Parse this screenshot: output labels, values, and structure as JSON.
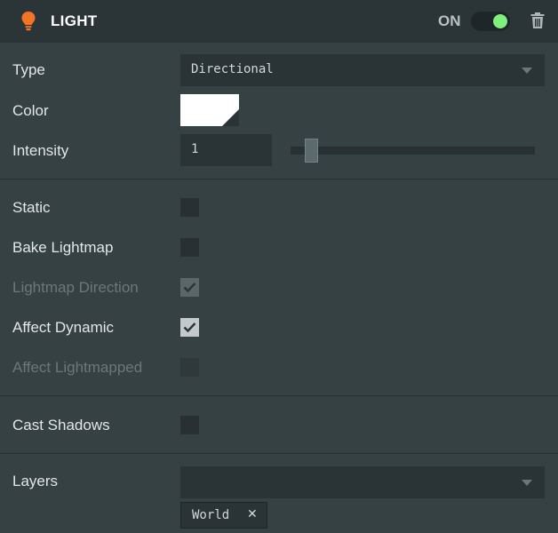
{
  "header": {
    "title": "LIGHT",
    "toggle_label": "ON",
    "enabled": true,
    "icons": {
      "bulb": "lightbulb-icon",
      "delete": "trash-icon"
    },
    "colors": {
      "bulb": "#f27424",
      "toggle_on": "#7ef07b"
    }
  },
  "type": {
    "label": "Type",
    "value": "Directional"
  },
  "color": {
    "label": "Color",
    "value": "#ffffff"
  },
  "intensity": {
    "label": "Intensity",
    "value": "1",
    "slider_fraction": 0.06
  },
  "static": {
    "label": "Static",
    "checked": false
  },
  "bake_lightmap": {
    "label": "Bake Lightmap",
    "checked": false
  },
  "lightmap_direction": {
    "label": "Lightmap Direction",
    "checked": true,
    "disabled": true
  },
  "affect_dynamic": {
    "label": "Affect Dynamic",
    "checked": true
  },
  "affect_lightmapped": {
    "label": "Affect Lightmapped",
    "checked": false,
    "disabled": true
  },
  "cast_shadows": {
    "label": "Cast Shadows",
    "checked": false
  },
  "layers": {
    "label": "Layers",
    "value": "",
    "tags": [
      "World"
    ]
  }
}
